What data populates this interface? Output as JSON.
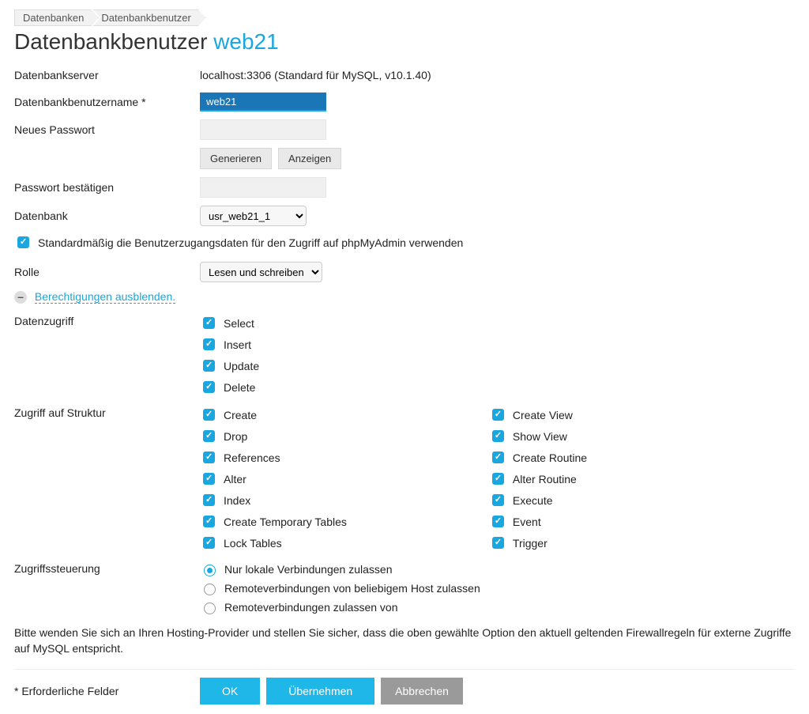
{
  "breadcrumb": [
    "Datenbanken",
    "Datenbankbenutzer"
  ],
  "title_prefix": "Datenbankbenutzer ",
  "title_accent": "web21",
  "server": {
    "label": "Datenbankserver",
    "value": "localhost:3306 (Standard für MySQL, v10.1.40)"
  },
  "username": {
    "label": "Datenbankbenutzername *",
    "value": "web21"
  },
  "password": {
    "label": "Neues Passwort",
    "generate": "Generieren",
    "show": "Anzeigen"
  },
  "confirm": {
    "label": "Passwort bestätigen"
  },
  "database": {
    "label": "Datenbank",
    "value": "usr_web21_1"
  },
  "default_access": "Standardmäßig die Benutzerzugangsdaten für den Zugriff auf phpMyAdmin verwenden",
  "role": {
    "label": "Rolle",
    "value": "Lesen und schreiben"
  },
  "toggle_perms": "Berechtigungen ausblenden.",
  "data_access": {
    "label": "Datenzugriff",
    "items": [
      "Select",
      "Insert",
      "Update",
      "Delete"
    ]
  },
  "structure_access": {
    "label": "Zugriff auf Struktur",
    "col1": [
      "Create",
      "Drop",
      "References",
      "Alter",
      "Index",
      "Create Temporary Tables",
      "Lock Tables"
    ],
    "col2": [
      "Create View",
      "Show View",
      "Create Routine",
      "Alter Routine",
      "Execute",
      "Event",
      "Trigger"
    ]
  },
  "access_control": {
    "label": "Zugriffssteuerung",
    "options": [
      "Nur lokale Verbindungen zulassen",
      "Remoteverbindungen von beliebigem Host zulassen",
      "Remoteverbindungen zulassen von"
    ]
  },
  "note": "Bitte wenden Sie sich an Ihren Hosting-Provider und stellen Sie sicher, dass die oben gewählte Option den aktuell geltenden Firewallregeln für externe Zugriffe auf MySQL entspricht.",
  "required_note": "* Erforderliche Felder",
  "buttons": {
    "ok": "OK",
    "apply": "Übernehmen",
    "cancel": "Abbrechen"
  }
}
